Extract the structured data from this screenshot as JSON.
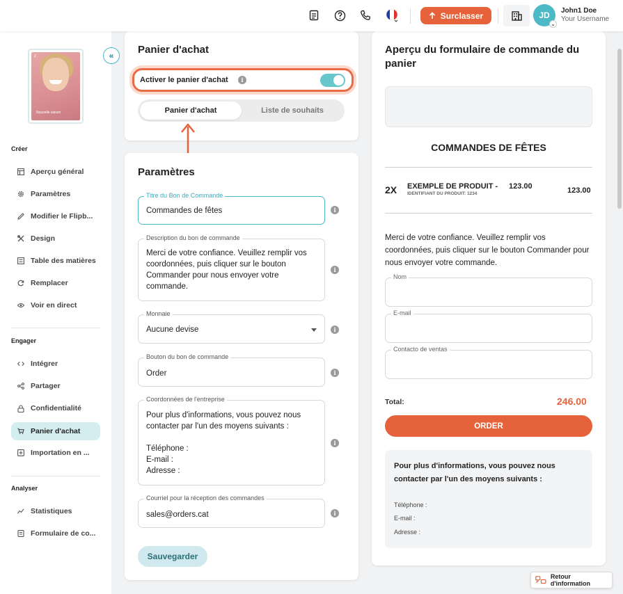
{
  "header": {
    "upgrade_label": "Surclasser",
    "avatar_initials": "JD",
    "user_name": "John1 Doe",
    "user_sub": "Your Username"
  },
  "sidebar": {
    "cover_brand": "Z",
    "cover_text": "Nouvelle saison",
    "sections": [
      {
        "title": "Créer",
        "items": [
          {
            "label": "Aperçu général",
            "icon": "layout-icon"
          },
          {
            "label": "Paramètres",
            "icon": "gear-icon"
          },
          {
            "label": "Modifier le Flipb...",
            "icon": "pencil-icon"
          },
          {
            "label": "Design",
            "icon": "design-tools-icon"
          },
          {
            "label": "Table des matières",
            "icon": "list-icon"
          },
          {
            "label": "Remplacer",
            "icon": "refresh-icon"
          },
          {
            "label": "Voir en direct",
            "icon": "eye-icon"
          }
        ]
      },
      {
        "title": "Engager",
        "items": [
          {
            "label": "Intégrer",
            "icon": "code-icon"
          },
          {
            "label": "Partager",
            "icon": "share-icon"
          },
          {
            "label": "Confidentialité",
            "icon": "lock-icon"
          },
          {
            "label": "Panier d'achat",
            "icon": "cart-icon",
            "active": true
          },
          {
            "label": "Importation en ...",
            "icon": "import-icon"
          }
        ]
      },
      {
        "title": "Analyser",
        "items": [
          {
            "label": "Statistiques",
            "icon": "stats-icon"
          },
          {
            "label": "Formulaire de co...",
            "icon": "form-icon"
          }
        ]
      }
    ]
  },
  "cart": {
    "title": "Panier d'achat",
    "toggle_label": "Activer le panier d'achat",
    "toggle_on": true,
    "tabs": [
      "Panier d'achat",
      "Liste de souhaits"
    ],
    "active_tab": 0
  },
  "params": {
    "title": "Paramètres",
    "fields": {
      "order_title": {
        "label": "Titre du Bon de Commande",
        "value": "Commandes de fêtes"
      },
      "description": {
        "label": "Description du bon de commande",
        "value": "Merci de votre confiance. Veuillez remplir vos\ncoordonnées, puis cliquer sur le bouton\nCommander pour nous envoyer votre\ncommande."
      },
      "currency": {
        "label": "Monnaie",
        "value": "Aucune devise"
      },
      "button": {
        "label": "Bouton du bon de commande",
        "value": "Order"
      },
      "company": {
        "label": "Coordonnées de l'entreprise",
        "value": "Pour plus d'informations, vous pouvez nous\ncontacter par l'un des moyens suivants :\n\nTéléphone :\nE-mail :\nAdresse :"
      },
      "email": {
        "label": "Courriel pour la réception des commandes",
        "value": "sales@orders.cat"
      }
    },
    "save_label": "Sauvegarder"
  },
  "preview": {
    "title": "Aperçu du formulaire de commande du panier",
    "order_title": "COMMANDES DE FÊTES",
    "product": {
      "qty": "2X",
      "name": "EXEMPLE DE PRODUIT -",
      "unit_price": "123.00",
      "id_line": "IDENTIFIANT DU PRODUIT: 1234",
      "price": "123.00"
    },
    "description": "Merci de votre confiance. Veuillez remplir vos coordonnées, puis cliquer sur le bouton Commander pour nous envoyer votre commande.",
    "fields": [
      "Nom",
      "E-mail",
      "Contacto de ventas"
    ],
    "total_label": "Total:",
    "total_value": "246.00",
    "order_label": "ORDER",
    "contact_title": "Pour plus d'informations, vous pouvez nous contacter par l'un des moyens suivants :",
    "contact_lines": [
      "Téléphone :",
      "E-mail :",
      "Adresse :"
    ]
  },
  "footer": {
    "feedback_label": "Retour d'information"
  },
  "colors": {
    "accent": "#e5623a",
    "teal": "#4bb9c6",
    "active_nav": "#d4edf0"
  }
}
